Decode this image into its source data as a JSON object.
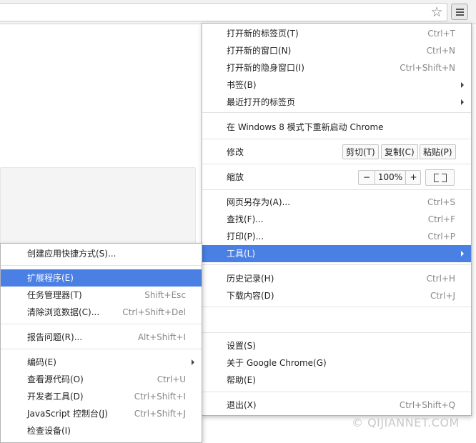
{
  "toolbar": {
    "star_icon": "star-icon",
    "menu_icon": "hamburger-menu-icon"
  },
  "main_menu": {
    "items": [
      {
        "label": "打开新的标签页(T)",
        "shortcut": "Ctrl+T"
      },
      {
        "label": "打开新的窗口(N)",
        "shortcut": "Ctrl+N"
      },
      {
        "label": "打开新的隐身窗口(I)",
        "shortcut": "Ctrl+Shift+N"
      },
      {
        "label": "书签(B)"
      },
      {
        "label": "最近打开的标签页"
      },
      {
        "label": "在 Windows 8 模式下重新启动 Chrome"
      },
      {
        "label": "修改"
      },
      {
        "label": "缩放"
      },
      {
        "label": "网页另存为(A)...",
        "shortcut": "Ctrl+S"
      },
      {
        "label": "查找(F)...",
        "shortcut": "Ctrl+F"
      },
      {
        "label": "打印(P)...",
        "shortcut": "Ctrl+P"
      },
      {
        "label": "工具(L)"
      },
      {
        "label": "历史记录(H)",
        "shortcut": "Ctrl+H"
      },
      {
        "label": "下载内容(D)",
        "shortcut": "Ctrl+J"
      },
      {
        "label": "设置(S)"
      },
      {
        "label": "关于 Google Chrome(G)"
      },
      {
        "label": "帮助(E)"
      },
      {
        "label": "退出(X)",
        "shortcut": "Ctrl+Shift+Q"
      }
    ],
    "edit_buttons": {
      "cut": "剪切(T)",
      "copy": "复制(C)",
      "paste": "粘贴(P)"
    },
    "zoom": {
      "minus": "−",
      "value": "100%",
      "plus": "+"
    }
  },
  "sub_menu": {
    "items": [
      {
        "label": "创建应用快捷方式(S)..."
      },
      {
        "label": "扩展程序(E)"
      },
      {
        "label": "任务管理器(T)",
        "shortcut": "Shift+Esc"
      },
      {
        "label": "清除浏览数据(C)...",
        "shortcut": "Ctrl+Shift+Del"
      },
      {
        "label": "报告问题(R)...",
        "shortcut": "Alt+Shift+I"
      },
      {
        "label": "编码(E)"
      },
      {
        "label": "查看源代码(O)",
        "shortcut": "Ctrl+U"
      },
      {
        "label": "开发者工具(D)",
        "shortcut": "Ctrl+Shift+I"
      },
      {
        "label": "JavaScript 控制台(J)",
        "shortcut": "Ctrl+Shift+J"
      },
      {
        "label": "检查设备(I)"
      }
    ]
  },
  "watermark": "© QIJIANNET.COM",
  "colors": {
    "highlight": "#4a7fe4",
    "toolbar": "#f2f2f2"
  }
}
